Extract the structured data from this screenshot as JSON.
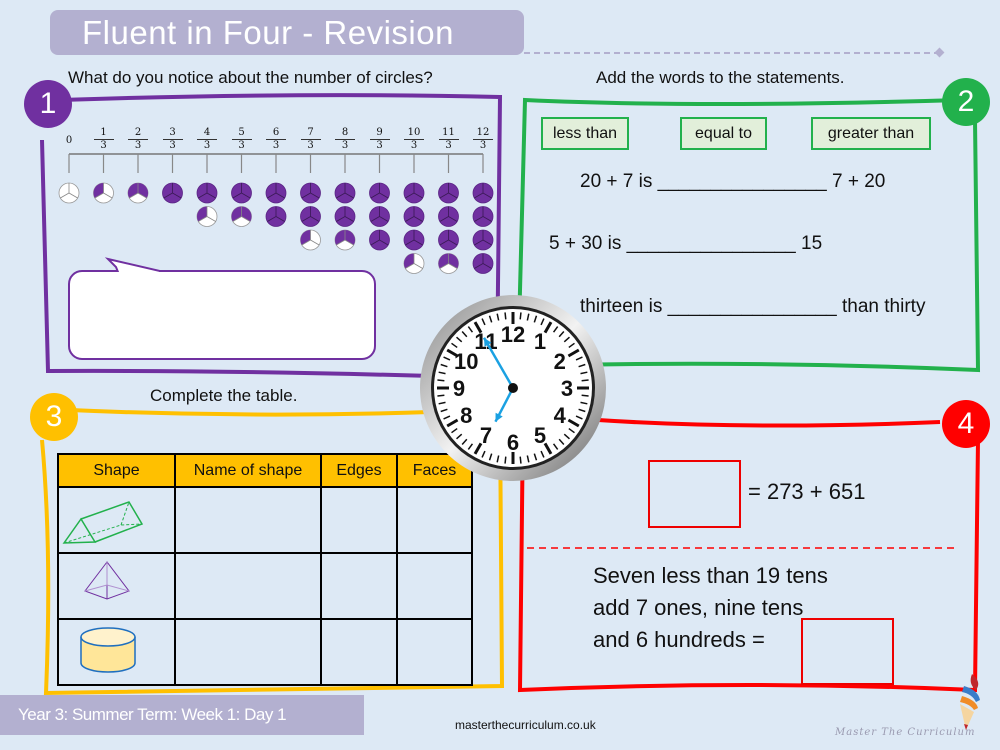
{
  "header": {
    "title": "Fluent in Four - Revision"
  },
  "colors": {
    "section1": "#7030a0",
    "section2": "#22b14c",
    "section3": "#ffc000",
    "section4": "#ff0000",
    "title_bar": "#b3b0d0",
    "background": "#dde9f5"
  },
  "section1": {
    "badge": "1",
    "prompt": "What do you notice about the number of circles?",
    "number_line": {
      "start_label": "0",
      "denominator": "3",
      "numerators": [
        "1",
        "2",
        "3",
        "4",
        "5",
        "6",
        "7",
        "8",
        "9",
        "10",
        "11",
        "12"
      ]
    },
    "circle_columns": [
      {
        "value_thirds": 0
      },
      {
        "value_thirds": 1
      },
      {
        "value_thirds": 2
      },
      {
        "value_thirds": 3
      },
      {
        "value_thirds": 4
      },
      {
        "value_thirds": 5
      },
      {
        "value_thirds": 6
      },
      {
        "value_thirds": 7
      },
      {
        "value_thirds": 8
      },
      {
        "value_thirds": 9
      },
      {
        "value_thirds": 10
      },
      {
        "value_thirds": 11
      },
      {
        "value_thirds": 12
      }
    ],
    "answer_box_placeholder": ""
  },
  "section2": {
    "badge": "2",
    "prompt": "Add the words to the statements.",
    "word_cards": [
      "less than",
      "equal to",
      "greater than"
    ],
    "statements": [
      {
        "left": "20 + 7  is",
        "blank": "________________",
        "right": "7 + 20"
      },
      {
        "left": "5 + 30 is",
        "blank": "________________",
        "right": "15"
      },
      {
        "left": "thirteen is",
        "blank": "________________",
        "right": "than thirty"
      }
    ]
  },
  "clock": {
    "time_shown": "6:55",
    "numbers": [
      "12",
      "1",
      "2",
      "3",
      "4",
      "5",
      "6",
      "7",
      "8",
      "9",
      "10",
      "11"
    ],
    "hand_color": "#1ba1e2"
  },
  "section3": {
    "badge": "3",
    "prompt": "Complete the table.",
    "table": {
      "headers": [
        "Shape",
        "Name of shape",
        "Edges",
        "Faces"
      ],
      "rows": [
        {
          "shape": "triangular-prism",
          "name": "",
          "edges": "",
          "faces": ""
        },
        {
          "shape": "square-based-pyramid",
          "name": "",
          "edges": "",
          "faces": ""
        },
        {
          "shape": "cylinder",
          "name": "",
          "edges": "",
          "faces": ""
        }
      ]
    }
  },
  "section4": {
    "badge": "4",
    "equation": "= 273 + 651",
    "word_problem": [
      "Seven less than 19 tens",
      "add 7 ones, nine tens",
      "and 6 hundreds ="
    ]
  },
  "footer": {
    "lesson": "Year 3: Summer Term: Week 1: Day 1",
    "url": "masterthecurriculum.co.uk",
    "brand": "Master  The  Curriculum"
  }
}
